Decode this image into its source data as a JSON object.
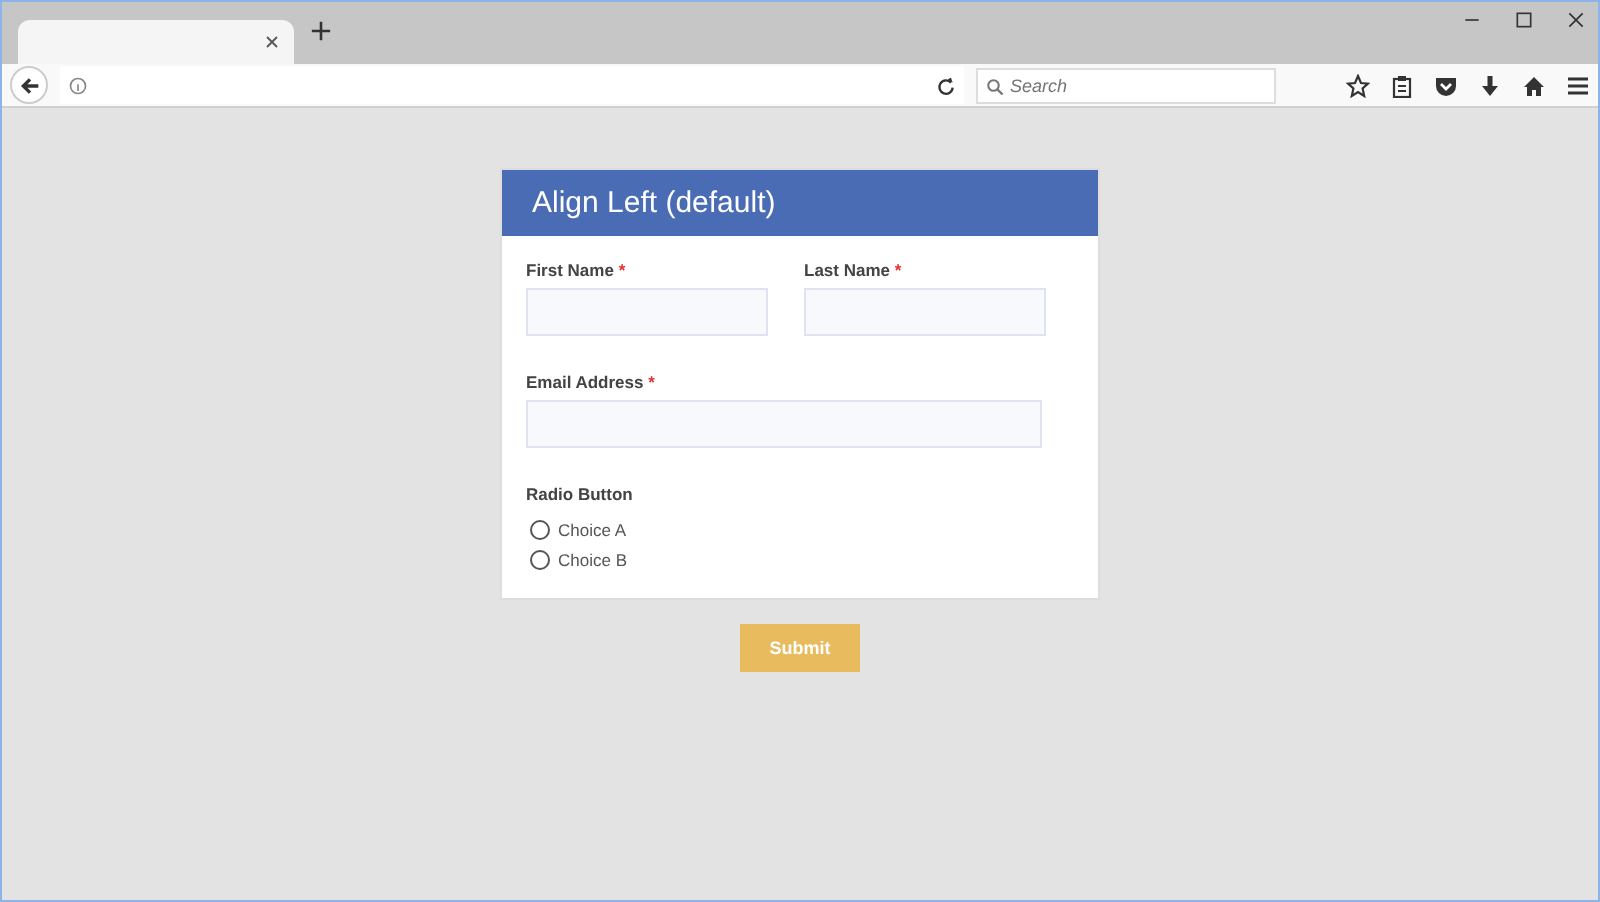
{
  "browser": {
    "search": {
      "placeholder": "Search"
    }
  },
  "form": {
    "title": "Align Left (default)",
    "name_fields": [
      {
        "label": "First Name",
        "required_mark": "*"
      },
      {
        "label": "Last Name",
        "required_mark": "*"
      }
    ],
    "email_field": {
      "label": "Email Address",
      "required_mark": "*"
    },
    "radio_group": {
      "label": "Radio Button",
      "options": [
        {
          "label": "Choice A",
          "selected": false
        },
        {
          "label": "Choice B",
          "selected": false
        }
      ]
    },
    "submit": "Submit"
  }
}
